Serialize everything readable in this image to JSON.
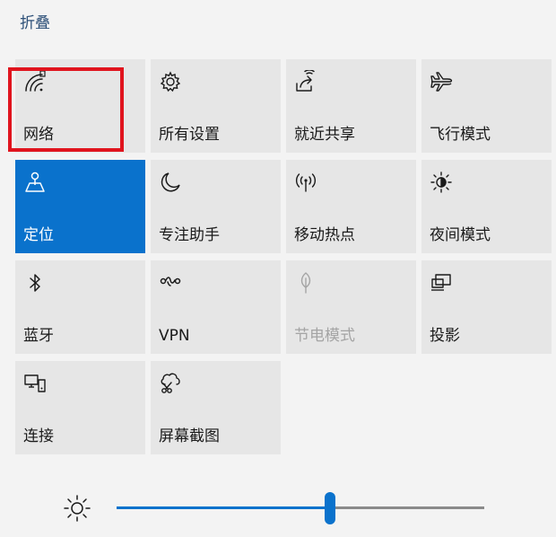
{
  "header": {
    "collapse_label": "折叠"
  },
  "tiles": [
    {
      "label": "网络",
      "icon": "network-signal-icon",
      "state": "normal"
    },
    {
      "label": "所有设置",
      "icon": "gear-icon",
      "state": "normal"
    },
    {
      "label": "就近共享",
      "icon": "nearby-share-icon",
      "state": "normal"
    },
    {
      "label": "飞行模式",
      "icon": "airplane-icon",
      "state": "normal"
    },
    {
      "label": "定位",
      "icon": "location-icon",
      "state": "active"
    },
    {
      "label": "专注助手",
      "icon": "moon-icon",
      "state": "normal"
    },
    {
      "label": "移动热点",
      "icon": "hotspot-icon",
      "state": "normal"
    },
    {
      "label": "夜间模式",
      "icon": "night-light-icon",
      "state": "normal"
    },
    {
      "label": "蓝牙",
      "icon": "bluetooth-icon",
      "state": "normal"
    },
    {
      "label": "VPN",
      "icon": "vpn-icon",
      "state": "normal"
    },
    {
      "label": "节电模式",
      "icon": "battery-saver-icon",
      "state": "disabled"
    },
    {
      "label": "投影",
      "icon": "project-icon",
      "state": "normal"
    },
    {
      "label": "连接",
      "icon": "connect-icon",
      "state": "normal"
    },
    {
      "label": "屏幕截图",
      "icon": "screen-snip-icon",
      "state": "normal"
    }
  ],
  "brightness": {
    "icon": "brightness-sun-icon",
    "level": 0.58
  },
  "colors": {
    "accent": "#0a72cc",
    "tile_background": "#e6e6e6",
    "panel_background": "#f3f3f3",
    "highlight": "#e0141e",
    "disabled_text": "#a4a4a4"
  }
}
